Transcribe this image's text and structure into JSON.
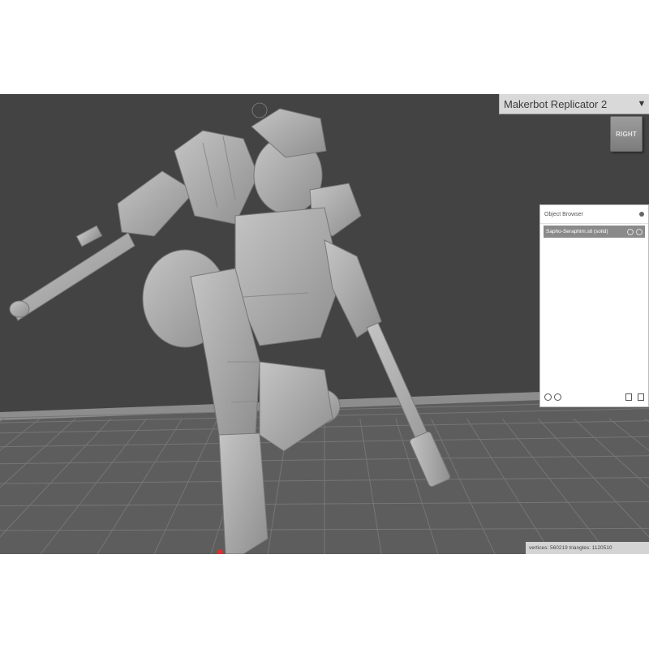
{
  "printer": {
    "name": "Makerbot Replicator 2",
    "arrow_icon": "triangle-down-icon"
  },
  "view_cube": {
    "label": "RIGHT"
  },
  "object_browser": {
    "title": "Object Browser",
    "items": [
      {
        "label": "Sapho-Seraphim.stl (solid)",
        "selected": true
      }
    ]
  },
  "stats": {
    "text": "vertices: 560219 triangles: 1120510"
  },
  "colors": {
    "viewport_bg": "#434343",
    "floor": "#5d5d5d",
    "grid": "#7a7a7a",
    "model": "#a9a9a9",
    "selected_item": "#8a8a8a",
    "origin_marker": "#d93030"
  }
}
